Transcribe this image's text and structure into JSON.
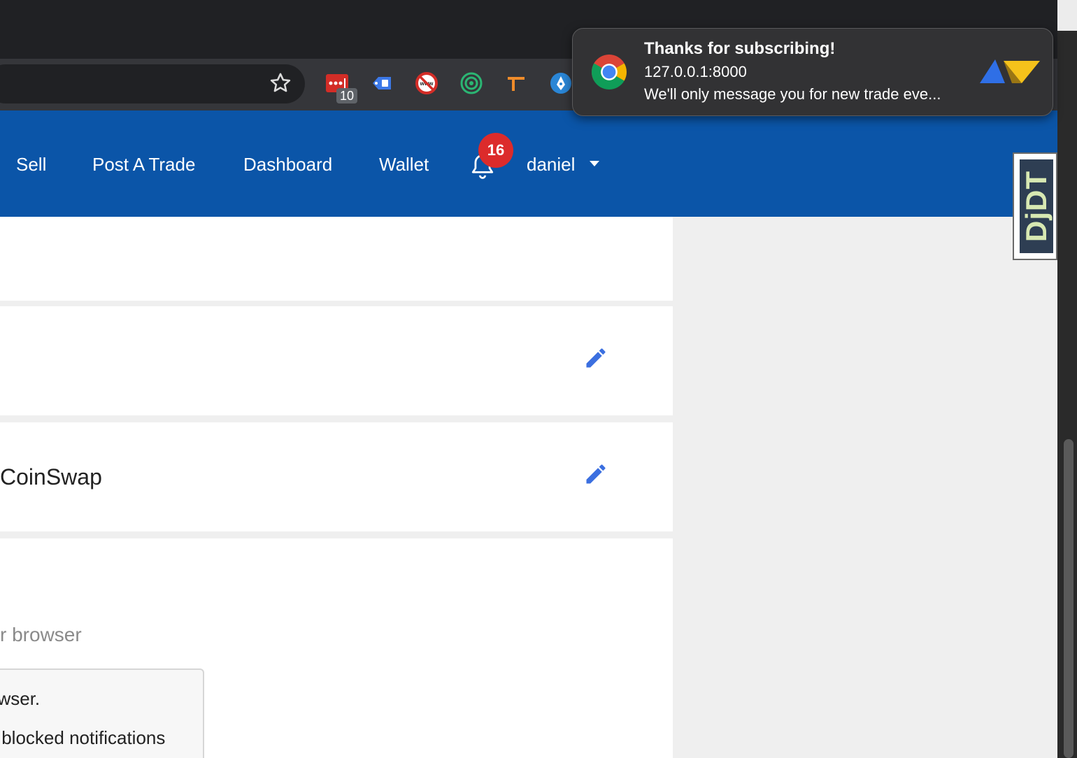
{
  "browser": {
    "extension_badge": "10"
  },
  "navbar": {
    "links": [
      "Sell",
      "Post A Trade",
      "Dashboard",
      "Wallet"
    ],
    "notification_count": "16",
    "user_name": "daniel"
  },
  "main": {
    "card3_title": "CoinSwap",
    "browser_text": "r browser",
    "info_lines": [
      "owser.",
      "y blocked notifications"
    ]
  },
  "side_widget": {
    "text": "DjDT"
  },
  "notification": {
    "title": "Thanks for subscribing!",
    "origin": "127.0.0.1:8000",
    "body": "We'll only message you for new trade eve..."
  },
  "colors": {
    "navbar": "#0b55a8",
    "badge": "#dc2b2b",
    "edit_icon": "#3b6fe0"
  }
}
